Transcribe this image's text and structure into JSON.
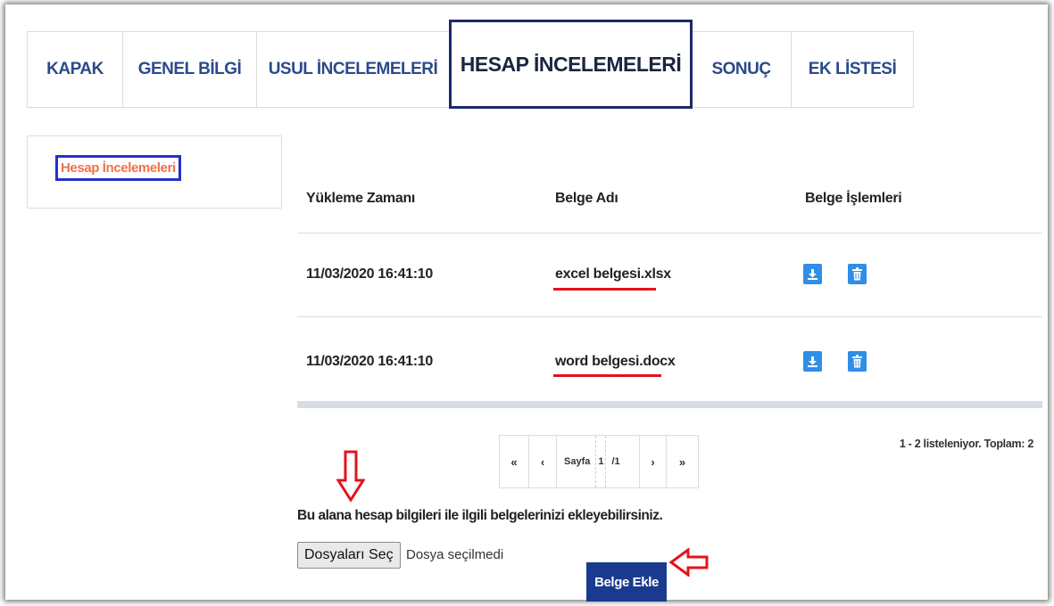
{
  "tabs": [
    {
      "label": "KAPAK"
    },
    {
      "label": "GENEL BİLGİ"
    },
    {
      "label": "USUL İNCELEMELERİ"
    },
    {
      "label": "HESAP İNCELEMELERİ",
      "active": true
    },
    {
      "label": "SONUÇ"
    },
    {
      "label": "EK LİSTESİ"
    }
  ],
  "sidebar": {
    "item_label": "Hesap İncelemeleri"
  },
  "table": {
    "columns": [
      "Yükleme Zamanı",
      "Belge Adı",
      "Belge İşlemleri"
    ],
    "rows": [
      {
        "time": "11/03/2020 16:41:10",
        "name": "excel belgesi.xlsx",
        "actions": [
          "download-icon",
          "trash-icon"
        ]
      },
      {
        "time": "11/03/2020 16:41:10",
        "name": "word belgesi.docx",
        "actions": [
          "download-icon",
          "trash-icon"
        ]
      }
    ]
  },
  "pager": {
    "first": "«",
    "prev": "‹",
    "page_label": "Sayfa",
    "current": "1",
    "total": "/1",
    "next": "›",
    "last": "»"
  },
  "listing_summary": "1 - 2 listeleniyor. Toplam: 2",
  "upload": {
    "info": "Bu alana hesap bilgileri ile ilgili belgelerinizi ekleyebilirsiniz.",
    "choose_button": "Dosyaları Seç",
    "file_status": "Dosya seçilmedi",
    "add_button": "Belge Ekle"
  },
  "colors": {
    "tab_text": "#2b4a8a",
    "active_tab_border": "#1b2a6b",
    "sidebar_text": "#f0714a",
    "sidebar_border": "#2730c9",
    "icon_button": "#2f8ee6",
    "add_button": "#1a3a8f",
    "annotation_red": "#e3131b"
  }
}
